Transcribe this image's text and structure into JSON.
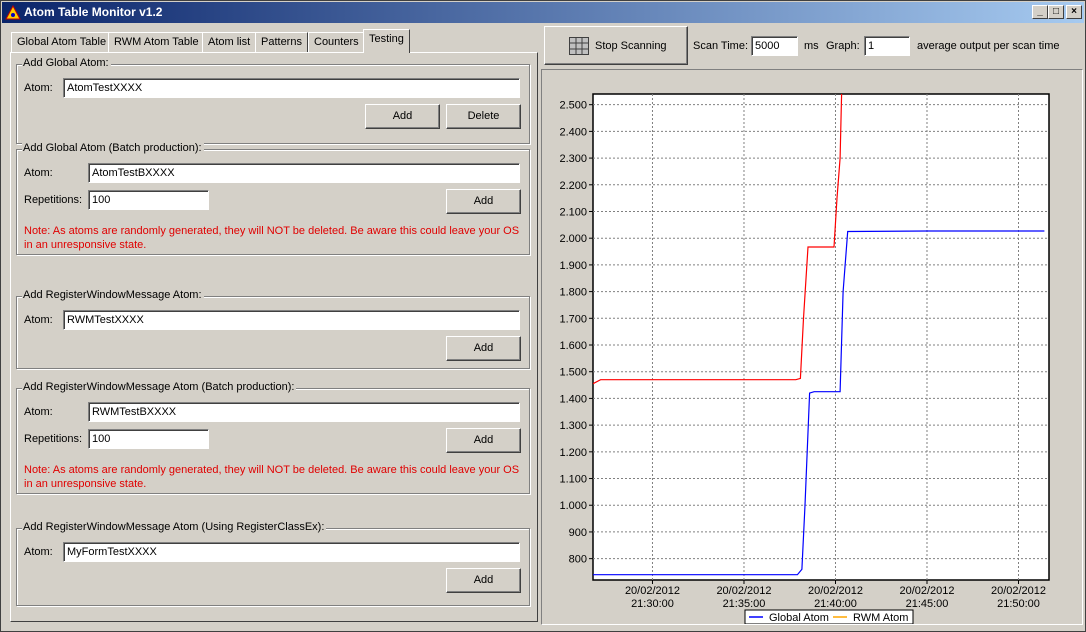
{
  "window": {
    "title": "Atom Table Monitor v1.2"
  },
  "tabs": [
    "Global Atom Table",
    "RWM Atom Table",
    "Atom list",
    "Patterns",
    "Counters",
    "Testing"
  ],
  "active_tab": "Testing",
  "groups": {
    "global_atom": {
      "legend": "Add Global Atom:",
      "atom_label": "Atom:",
      "atom_value": "AtomTestXXXX",
      "add": "Add",
      "delete": "Delete"
    },
    "global_batch": {
      "legend": "Add Global Atom (Batch production):",
      "atom_label": "Atom:",
      "atom_value": "AtomTestBXXXX",
      "rep_label": "Repetitions:",
      "rep_value": "100",
      "add": "Add",
      "note_line1": "Note: As atoms are randomly generated, they will NOT be deleted. Be aware this could leave your OS",
      "note_line2": "in an unresponsive state."
    },
    "rwm_atom": {
      "legend": "Add RegisterWindowMessage Atom:",
      "atom_label": "Atom:",
      "atom_value": "RWMTestXXXX",
      "add": "Add"
    },
    "rwm_batch": {
      "legend": "Add RegisterWindowMessage Atom (Batch production):",
      "atom_label": "Atom:",
      "atom_value": "RWMTestBXXXX",
      "rep_label": "Repetitions:",
      "rep_value": "100",
      "add": "Add",
      "note_line1": "Note: As atoms are randomly generated, they will NOT be deleted. Be aware this could leave your OS",
      "note_line2": "in an unresponsive state."
    },
    "rwm_class": {
      "legend": "Add RegisterWindowMessage Atom (Using RegisterClassEx):",
      "atom_label": "Atom:",
      "atom_value": "MyFormTestXXXX",
      "add": "Add"
    }
  },
  "toolbar": {
    "stop_scanning": "Stop Scanning",
    "scan_time_label": "Scan Time:",
    "scan_time_value": "5000",
    "ms_label": "ms",
    "graph_label": "Graph:",
    "graph_value": "1",
    "avg_label": "average output per scan time"
  },
  "colors": {
    "global": "#0000ff",
    "rwm": "#ff0000"
  },
  "chart_data": {
    "type": "line",
    "ylim": [
      720,
      2540
    ],
    "yticks": [
      "2.500",
      "2.400",
      "2.300",
      "2.200",
      "2.100",
      "2.000",
      "1.900",
      "1.800",
      "1.700",
      "1.600",
      "1.500",
      "1.400",
      "1.300",
      "1.200",
      "1.100",
      "1.000",
      "900",
      "800"
    ],
    "ytick_values": [
      2500,
      2400,
      2300,
      2200,
      2100,
      2000,
      1900,
      1800,
      1700,
      1600,
      1500,
      1400,
      1300,
      1200,
      1100,
      1000,
      900,
      800
    ],
    "xlim": [
      "21:26:45",
      "21:51:40"
    ],
    "xticks": [
      {
        "date": "20/02/2012",
        "time": "21:30:00"
      },
      {
        "date": "20/02/2012",
        "time": "21:35:00"
      },
      {
        "date": "20/02/2012",
        "time": "21:40:00"
      },
      {
        "date": "20/02/2012",
        "time": "21:45:00"
      },
      {
        "date": "20/02/2012",
        "time": "21:50:00"
      }
    ],
    "legend_position": "bottom",
    "series": [
      {
        "name": "Global Atom",
        "color": "#0000ff",
        "x": [
          "21:26:45",
          "21:37:55",
          "21:38:10",
          "21:38:20",
          "21:38:35",
          "21:38:50",
          "21:39:50",
          "21:40:15",
          "21:40:25",
          "21:40:40",
          "21:45:00",
          "21:51:25"
        ],
        "y": [
          740,
          740,
          760,
          1000,
          1420,
          1425,
          1425,
          1425,
          1800,
          2025,
          2027,
          2027
        ]
      },
      {
        "name": "RWM Atom",
        "color": "#ffa500",
        "x": [
          "21:26:45",
          "21:27:10",
          "21:37:50",
          "21:38:05",
          "21:38:15",
          "21:38:30",
          "21:39:45",
          "21:39:55",
          "21:40:05",
          "21:40:15",
          "21:40:20"
        ],
        "y": [
          1455,
          1470,
          1470,
          1475,
          1700,
          1967,
          1967,
          1967,
          2150,
          2300,
          2540
        ]
      }
    ]
  }
}
